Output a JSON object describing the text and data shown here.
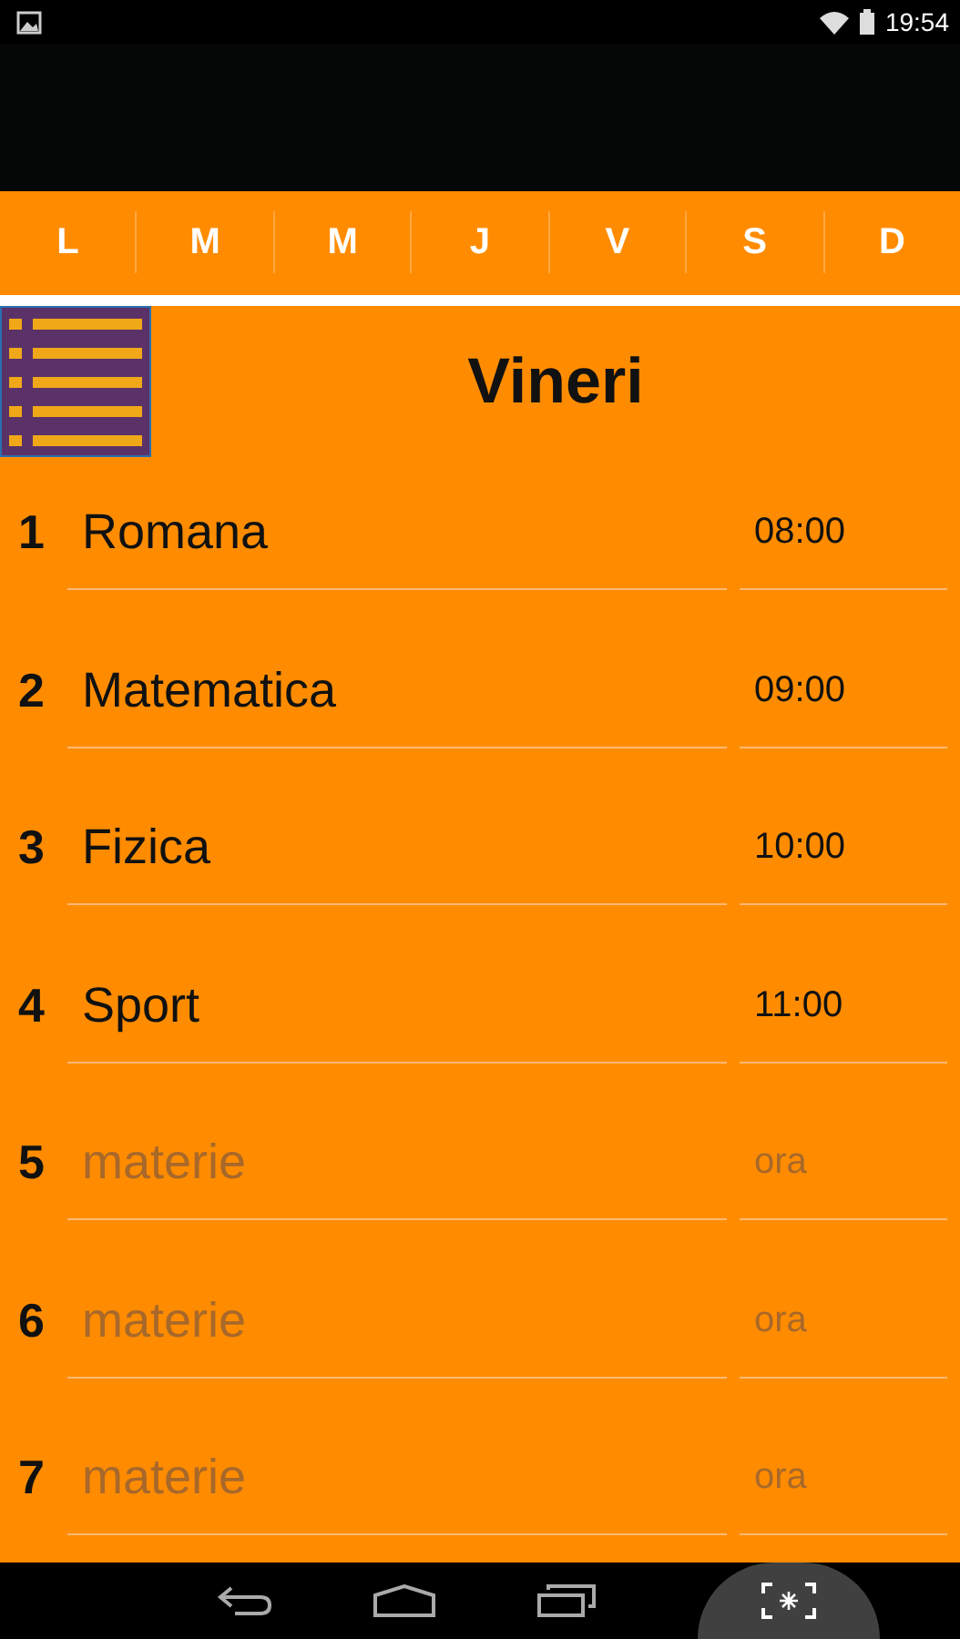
{
  "status_bar": {
    "time": "19:54"
  },
  "day_tabs": [
    {
      "label": "L"
    },
    {
      "label": "M"
    },
    {
      "label": "M"
    },
    {
      "label": "J"
    },
    {
      "label": "V"
    },
    {
      "label": "S"
    },
    {
      "label": "D"
    }
  ],
  "day_title": "Vineri",
  "rows": [
    {
      "number": "1",
      "subject": {
        "value": "Romana"
      },
      "time": {
        "value": "08:00"
      }
    },
    {
      "number": "2",
      "subject": {
        "value": "Matematica"
      },
      "time": {
        "value": "09:00"
      }
    },
    {
      "number": "3",
      "subject": {
        "value": "Fizica"
      },
      "time": {
        "value": "10:00"
      }
    },
    {
      "number": "4",
      "subject": {
        "value": "Sport"
      },
      "time": {
        "value": "11:00"
      }
    },
    {
      "number": "5",
      "subject": {
        "placeholder": "materie"
      },
      "time": {
        "placeholder": "ora"
      }
    },
    {
      "number": "6",
      "subject": {
        "placeholder": "materie"
      },
      "time": {
        "placeholder": "ora"
      }
    },
    {
      "number": "7",
      "subject": {
        "placeholder": "materie"
      },
      "time": {
        "placeholder": "ora"
      }
    }
  ]
}
